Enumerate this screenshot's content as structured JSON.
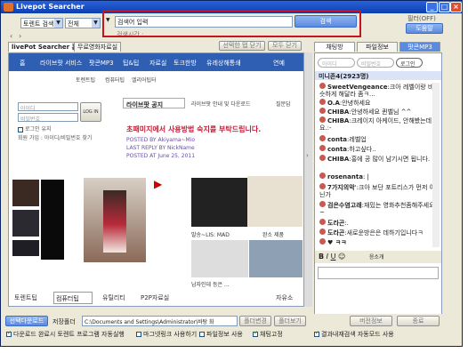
{
  "window": {
    "title": "Livepot Searcher"
  },
  "toolbar": {
    "search_type": "토렌트 검색",
    "scope": "전체",
    "search_placeholder": "검색어 입력",
    "search_button": "검색",
    "search_time_label": "검색시간 :",
    "filter_label": "필터(OFF)",
    "help_button": "도움말"
  },
  "tabs": [
    {
      "label": "livePot Searcher 홈"
    },
    {
      "label": "무료영화자료실"
    }
  ],
  "panel_buttons": {
    "close_selected": "선택한 탭 닫기",
    "close_all": "모두 닫기"
  },
  "right_tabs": [
    {
      "label": "채팅방"
    },
    {
      "label": "파일정보"
    },
    {
      "label": "팟콘MP3"
    }
  ],
  "login": {
    "id_placeholder": "아이디",
    "pw_placeholder": "비밀번호",
    "login_button": "로그인"
  },
  "chat": {
    "room": "미니존4(2923명)",
    "messages": [
      {
        "user": "SweetVengeance",
        "text": ":크아 레벨이랑 비슷하게 해달라 좀ㅋ..."
      },
      {
        "user": "O.A",
        "text": ":안녕하세요"
      },
      {
        "user": "CHIBA",
        "text": ":안녕하세요 퀸벨님 ^^"
      },
      {
        "user": "CHIBA",
        "text": ":크레이지 아케이드, 안해봤는데요.:-"
      },
      {
        "user": "conta",
        "text": ":레벨업"
      },
      {
        "user": "conta",
        "text": ":하고싶다.."
      },
      {
        "user": "CHIBA",
        "text": ":홍에 공 많이 남기시면 됩니다."
      },
      {
        "user": "rosenanta",
        "text": ": |"
      },
      {
        "user": "7가지의악",
        "text": "':크아 보단 포트리스가 먼저 아닌가"
      },
      {
        "user": "검은수염고래",
        "text": ":재밌는 영화추천좀해주세요~"
      },
      {
        "user": "도라곤",
        "text": ":."
      },
      {
        "user": "도라곤",
        "text": ":새로운방은은 데하기입니다ㅋ"
      },
      {
        "user": "♥ ㅋㅋ",
        "text": ""
      }
    ],
    "send_button": "입장하기",
    "send_label": "응소개"
  },
  "browser": {
    "nav": [
      "홈",
      "라이브팟 서비스",
      "팟콘MP3",
      "팁&팁",
      "자료실",
      "토크한방",
      "유레상해통쇄",
      "연예"
    ],
    "subnav": [
      "토렌트팁",
      "컴퓨터팁",
      "엘리어팁터"
    ],
    "login_id": "아이디",
    "login_pw": "비밀번호",
    "login_btn": "LOG IN",
    "save_id": "로그인 유지",
    "member_links": "회원 가입 : 아이디/비밀번호 찾기",
    "article_tabs": [
      "라이브팟 공지",
      "라이브팟 안내 및 다운로드",
      "질문답"
    ],
    "article_title": "초패미지에서 사용방법 숙지를 부탁드립니다.",
    "posted_by": "POSTED BY Akiyama~Mio",
    "last_reply": "LAST REPLY BY NickName",
    "posted_at": "POSTED AT June 25, 2011",
    "video_caption1": "말송~LIS: MAD",
    "video_caption2": "완소 제품",
    "caption3": "남자인데 등은 ...",
    "bottom_tabs": [
      "토렌트팁",
      "컴퓨터팁",
      "유틸리티",
      "P2P자료실"
    ],
    "bottom_right": "자유소"
  },
  "status": {
    "mode_button": "선택다운로드",
    "save_folder_label": "저장폴더",
    "path": "C:\\Documents and Settings\\Administrator\\바탕 화",
    "folder_change": "폴더변경",
    "folder_open": "폴더보기",
    "update_button": "버전정보",
    "apply_button": "종료",
    "options": [
      {
        "label": "다운로드 완료시 토렌트 프로그램 자동실행",
        "checked": true
      },
      {
        "label": "마그넷링크 사용하기",
        "checked": false
      },
      {
        "label": "파일정보 사용",
        "checked": false
      },
      {
        "label": "채팅고정",
        "checked": true
      },
      {
        "label": "결과내재검색 자동모드 사용",
        "checked": true
      }
    ]
  },
  "colors": {
    "accent": "#2f5fb3",
    "highlight": "#c8141e",
    "titlebar": "#0a3fb0"
  }
}
